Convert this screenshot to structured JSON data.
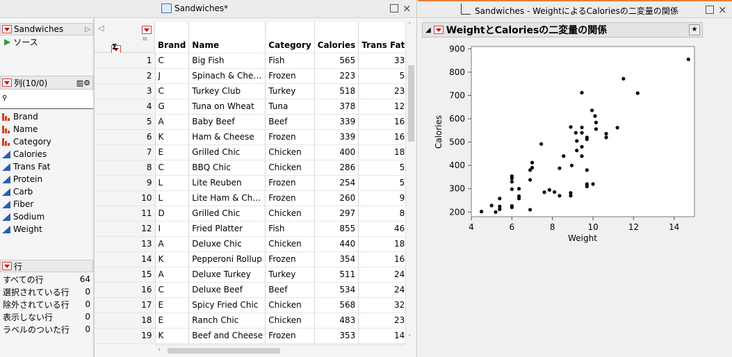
{
  "left_window": {
    "title": "Sandwiches*",
    "table_panel_title": "Sandwiches",
    "source_label": "ソース",
    "columns_panel_title": "列(10/0)",
    "search_placeholder": "",
    "columns": [
      {
        "name": "Brand",
        "type": "nominal"
      },
      {
        "name": "Name",
        "type": "nominal"
      },
      {
        "name": "Category",
        "type": "nominal"
      },
      {
        "name": "Calories",
        "type": "continuous"
      },
      {
        "name": "Trans Fat",
        "type": "continuous"
      },
      {
        "name": "Protein",
        "type": "continuous"
      },
      {
        "name": "Carb",
        "type": "continuous"
      },
      {
        "name": "Fiber",
        "type": "continuous"
      },
      {
        "name": "Sodium",
        "type": "continuous"
      },
      {
        "name": "Weight",
        "type": "continuous"
      }
    ],
    "rows_panel_title": "行",
    "row_stats": [
      {
        "label": "すべての行",
        "value": "64"
      },
      {
        "label": "選択されている行",
        "value": "0"
      },
      {
        "label": "除外されている行",
        "value": "0"
      },
      {
        "label": "表示しない行",
        "value": "0"
      },
      {
        "label": "ラベルのついた行",
        "value": "0"
      }
    ],
    "grid_headers": [
      "Brand",
      "Name",
      "Category",
      "Calories",
      "Trans Fat"
    ],
    "grid_rows": [
      [
        "1",
        "C",
        "Big Fish",
        "Fish",
        "565",
        "33"
      ],
      [
        "2",
        "J",
        "Spinach & Che…",
        "Frozen",
        "223",
        "5"
      ],
      [
        "3",
        "C",
        "Turkey Club",
        "Turkey",
        "518",
        "23"
      ],
      [
        "4",
        "G",
        "Tuna on Wheat",
        "Tuna",
        "378",
        "12"
      ],
      [
        "5",
        "A",
        "Baby Beef",
        "Beef",
        "339",
        "16"
      ],
      [
        "6",
        "K",
        "Ham & Cheese",
        "Frozen",
        "339",
        "16"
      ],
      [
        "7",
        "E",
        "Grilled Chic",
        "Chicken",
        "400",
        "18"
      ],
      [
        "8",
        "C",
        "BBQ Chic",
        "Chicken",
        "286",
        "5"
      ],
      [
        "9",
        "L",
        "Lite Reuben",
        "Frozen",
        "254",
        "5"
      ],
      [
        "10",
        "L",
        "Lite Ham & Ch…",
        "Frozen",
        "260",
        "9"
      ],
      [
        "11",
        "D",
        "Grilled Chic",
        "Chicken",
        "297",
        "8"
      ],
      [
        "12",
        "I",
        "Fried Platter",
        "Fish",
        "855",
        "46"
      ],
      [
        "13",
        "A",
        "Deluxe Chic",
        "Chicken",
        "440",
        "18"
      ],
      [
        "14",
        "K",
        "Pepperoni Rollup",
        "Frozen",
        "354",
        "16"
      ],
      [
        "15",
        "A",
        "Deluxe Turkey",
        "Turkey",
        "511",
        "24"
      ],
      [
        "16",
        "C",
        "Deluxe Beef",
        "Beef",
        "534",
        "24"
      ],
      [
        "17",
        "E",
        "Spicy Fried Chic",
        "Chicken",
        "568",
        "32"
      ],
      [
        "18",
        "E",
        "Ranch Chic",
        "Chicken",
        "483",
        "23"
      ],
      [
        "19",
        "K",
        "Beef and Cheese",
        "Frozen",
        "353",
        "14"
      ]
    ]
  },
  "right_window": {
    "title": "Sandwiches - WeightによるCaloriesの二変量の関係",
    "report_title": "WeightとCaloriesの二変量の関係"
  },
  "chart_data": {
    "type": "scatter",
    "xlabel": "Weight",
    "ylabel": "Calories",
    "xlim": [
      4,
      15
    ],
    "ylim": [
      180,
      910
    ],
    "xticks": [
      4,
      6,
      8,
      10,
      12,
      14
    ],
    "yticks": [
      200,
      300,
      400,
      500,
      600,
      700,
      800,
      900
    ],
    "points": [
      [
        4.5,
        202
      ],
      [
        5.0,
        228
      ],
      [
        5.2,
        200
      ],
      [
        5.4,
        224
      ],
      [
        5.4,
        212
      ],
      [
        5.4,
        258
      ],
      [
        6.0,
        220
      ],
      [
        6.0,
        226
      ],
      [
        6.0,
        298
      ],
      [
        6.0,
        330
      ],
      [
        6.0,
        354
      ],
      [
        6.0,
        345
      ],
      [
        6.35,
        300
      ],
      [
        6.35,
        268
      ],
      [
        6.35,
        258
      ],
      [
        6.9,
        210
      ],
      [
        6.9,
        338
      ],
      [
        6.9,
        380
      ],
      [
        7.0,
        390
      ],
      [
        7.0,
        412
      ],
      [
        7.45,
        492
      ],
      [
        7.6,
        285
      ],
      [
        7.85,
        295
      ],
      [
        8.1,
        286
      ],
      [
        8.35,
        270
      ],
      [
        8.35,
        388
      ],
      [
        8.55,
        440
      ],
      [
        8.9,
        282
      ],
      [
        8.9,
        270
      ],
      [
        8.9,
        565
      ],
      [
        8.95,
        400
      ],
      [
        9.15,
        540
      ],
      [
        9.2,
        505
      ],
      [
        9.2,
        464
      ],
      [
        9.45,
        712
      ],
      [
        9.45,
        563
      ],
      [
        9.45,
        540
      ],
      [
        9.45,
        480
      ],
      [
        9.45,
        440
      ],
      [
        9.7,
        520
      ],
      [
        9.7,
        512
      ],
      [
        9.7,
        380
      ],
      [
        9.7,
        320
      ],
      [
        9.7,
        310
      ],
      [
        9.95,
        636
      ],
      [
        10.0,
        320
      ],
      [
        10.1,
        612
      ],
      [
        10.15,
        584
      ],
      [
        10.15,
        556
      ],
      [
        10.65,
        536
      ],
      [
        10.65,
        520
      ],
      [
        11.2,
        562
      ],
      [
        11.5,
        772
      ],
      [
        12.2,
        710
      ],
      [
        14.7,
        855
      ]
    ]
  }
}
